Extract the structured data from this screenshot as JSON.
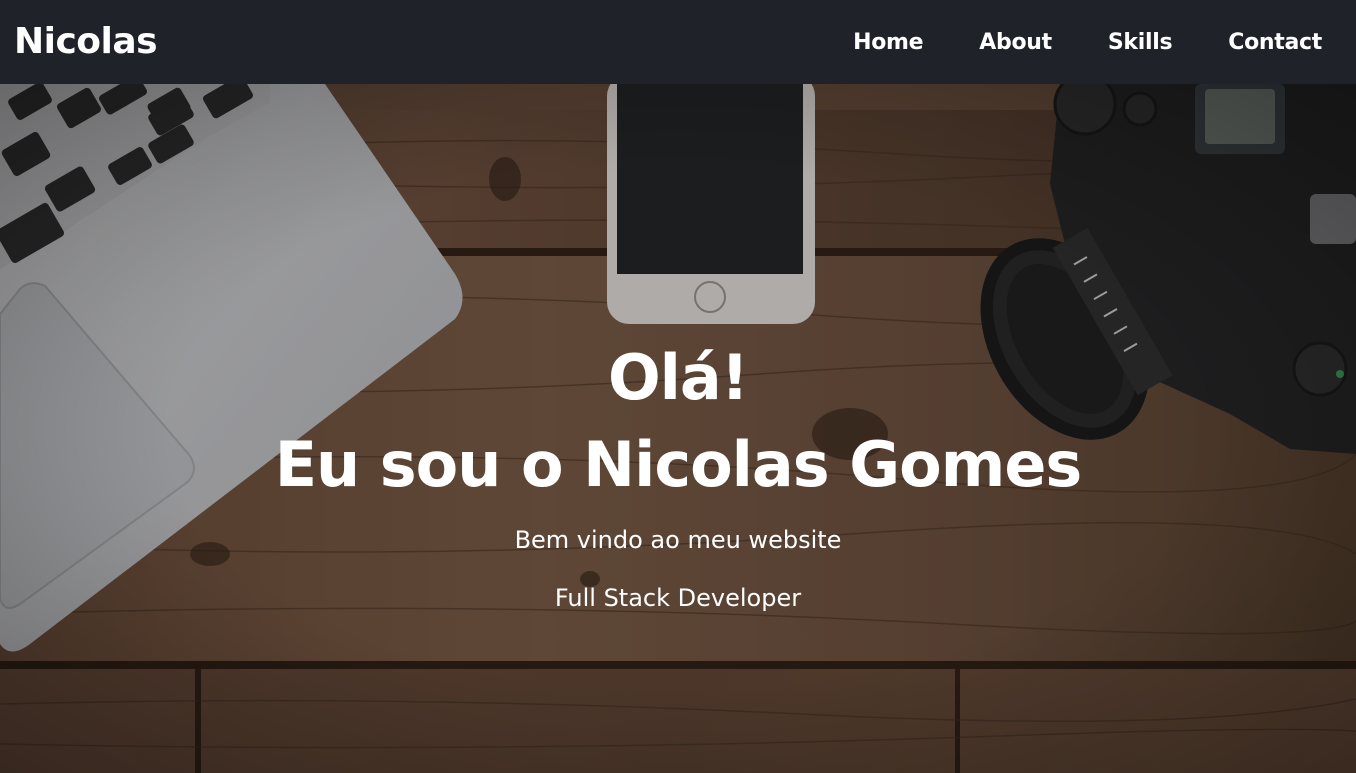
{
  "navbar": {
    "brand": "Nicolas",
    "links": [
      {
        "label": "Home"
      },
      {
        "label": "About"
      },
      {
        "label": "Skills"
      },
      {
        "label": "Contact"
      }
    ],
    "background_color": "#1f2228",
    "text_color": "#ffffff"
  },
  "hero": {
    "greeting": "Olá!",
    "headline": "Eu sou o Nicolas Gomes",
    "welcome": "Bem vindo ao meu website",
    "role": "Full Stack Developer",
    "background_image": "desk-laptop-phone-camera-photo",
    "text_color": "#ffffff"
  }
}
